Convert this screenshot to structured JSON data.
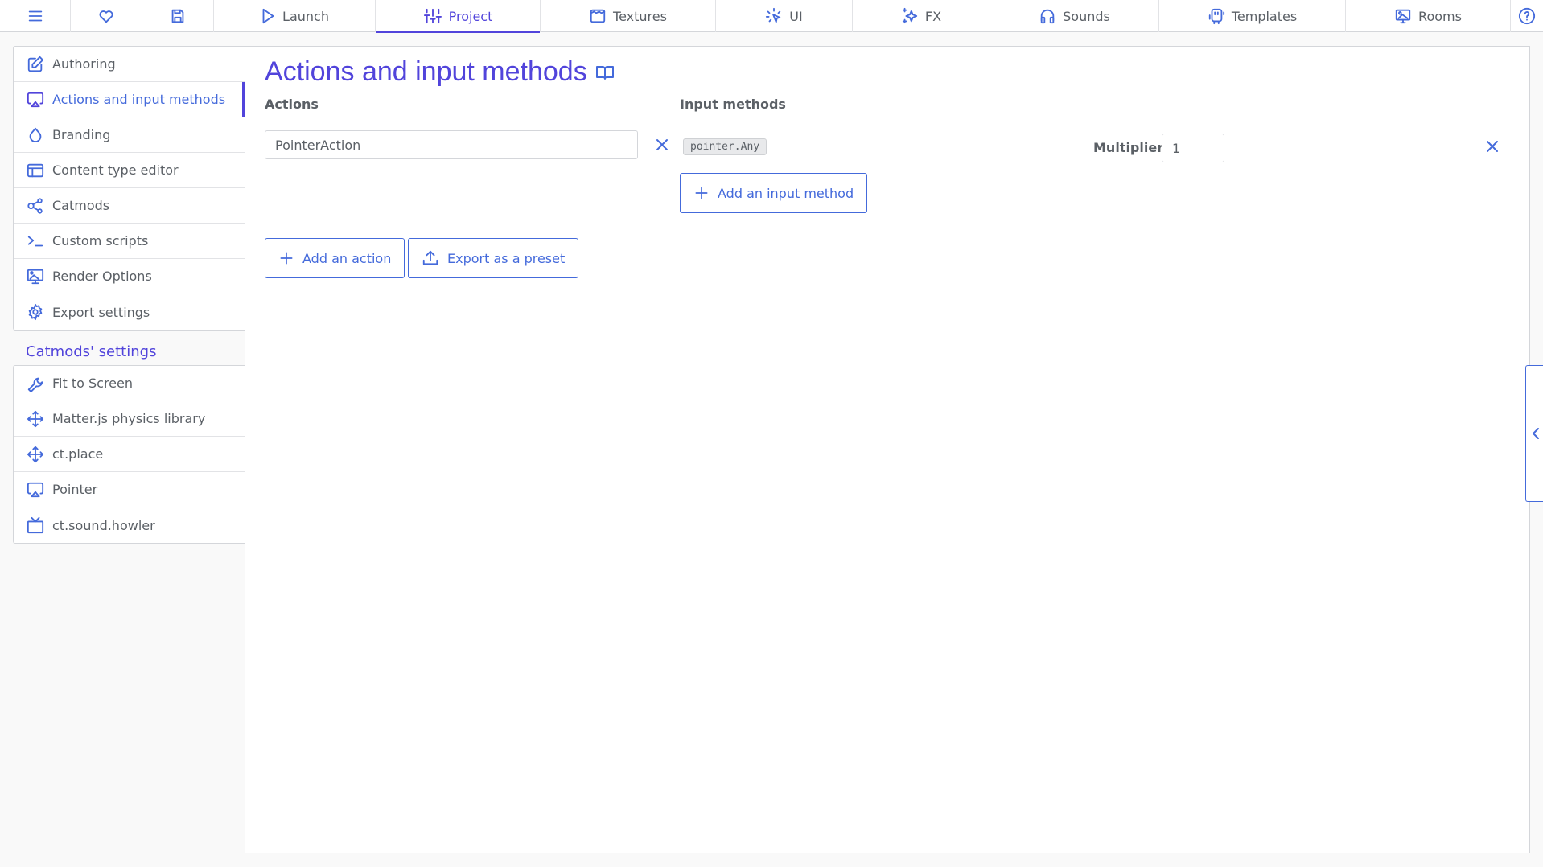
{
  "topbar": {
    "menu_icon": "hamburger-icon",
    "favorite_icon": "heart-icon",
    "save_icon": "floppy-disk-icon",
    "tabs": [
      {
        "label": "Launch",
        "icon": "play-icon"
      },
      {
        "label": "Project",
        "icon": "sliders-icon",
        "active": true
      },
      {
        "label": "Textures",
        "icon": "texture-icon"
      },
      {
        "label": "UI",
        "icon": "cursor-click-icon"
      },
      {
        "label": "FX",
        "icon": "sparkles-icon"
      },
      {
        "label": "Sounds",
        "icon": "headphones-icon"
      },
      {
        "label": "Templates",
        "icon": "template-icon"
      },
      {
        "label": "Rooms",
        "icon": "room-icon"
      }
    ],
    "help_icon": "help-circle-icon"
  },
  "sidebar": {
    "items": [
      {
        "label": "Authoring",
        "icon": "edit-icon"
      },
      {
        "label": "Actions and input methods",
        "icon": "airplay-icon",
        "active": true
      },
      {
        "label": "Branding",
        "icon": "droplet-icon"
      },
      {
        "label": "Content type editor",
        "icon": "layout-icon"
      },
      {
        "label": "Catmods",
        "icon": "share-nodes-icon"
      },
      {
        "label": "Custom scripts",
        "icon": "terminal-icon"
      },
      {
        "label": "Render Options",
        "icon": "monitor-image-icon"
      },
      {
        "label": "Export settings",
        "icon": "gear-icon"
      }
    ],
    "catmods_heading": "Catmods' settings",
    "catmods": [
      {
        "label": "Fit to Screen",
        "icon": "wrench-icon"
      },
      {
        "label": "Matter.js physics library",
        "icon": "move-icon"
      },
      {
        "label": "ct.place",
        "icon": "move-icon"
      },
      {
        "label": "Pointer",
        "icon": "airplay-icon"
      },
      {
        "label": "ct.sound.howler",
        "icon": "tv-icon"
      }
    ]
  },
  "main": {
    "title": "Actions and input methods",
    "docs_icon": "book-open-icon",
    "actions_label": "Actions",
    "input_methods_label": "Input methods",
    "actions": [
      {
        "name": "PointerAction",
        "input_methods": [
          {
            "code": "pointer.Any",
            "multiplier_label": "Multiplier:",
            "multiplier": "1"
          }
        ],
        "add_input_method_label": "Add an input method"
      }
    ],
    "add_action_label": "Add an action",
    "export_preset_label": "Export as a preset"
  },
  "colors": {
    "accent": "#5144db",
    "icon": "#446adb",
    "text": "#5b6066",
    "border": "#d4d6da"
  }
}
